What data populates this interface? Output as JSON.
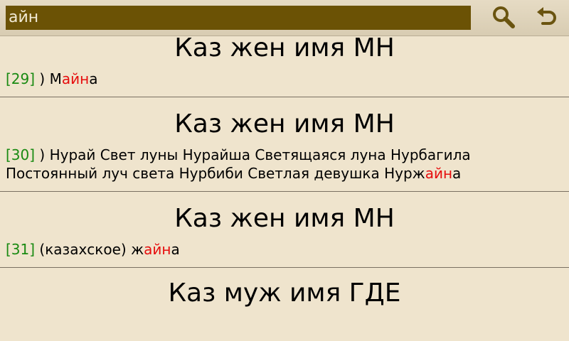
{
  "search": {
    "value": "айн"
  },
  "icons": {
    "search": "search-icon",
    "back": "back-arrow-icon"
  },
  "colors": {
    "number": "#1a8a12",
    "highlight": "#e60d0d",
    "search_bg": "#6b5205",
    "background": "#efe4cd"
  },
  "entries": [
    {
      "title": "Каз жен имя МН",
      "number": "[29]",
      "text_pre": " ) М",
      "text_hl": "айн",
      "text_post": "а"
    },
    {
      "title": "Каз жен имя МН",
      "number": "[30]",
      "text_pre": " ) Нурай   Свет луны Нурайша Светящаяся луна Нурбагила Постоянный луч света Нурбиби  Светлая девушка Нурж",
      "text_hl": "айн",
      "text_post": "а"
    },
    {
      "title": "Каз жен имя МН",
      "number": "[31]",
      "text_pre": " (казахское) ж",
      "text_hl": "айн",
      "text_post": "а"
    }
  ],
  "next_title": "Каз муж имя ГДЕ"
}
